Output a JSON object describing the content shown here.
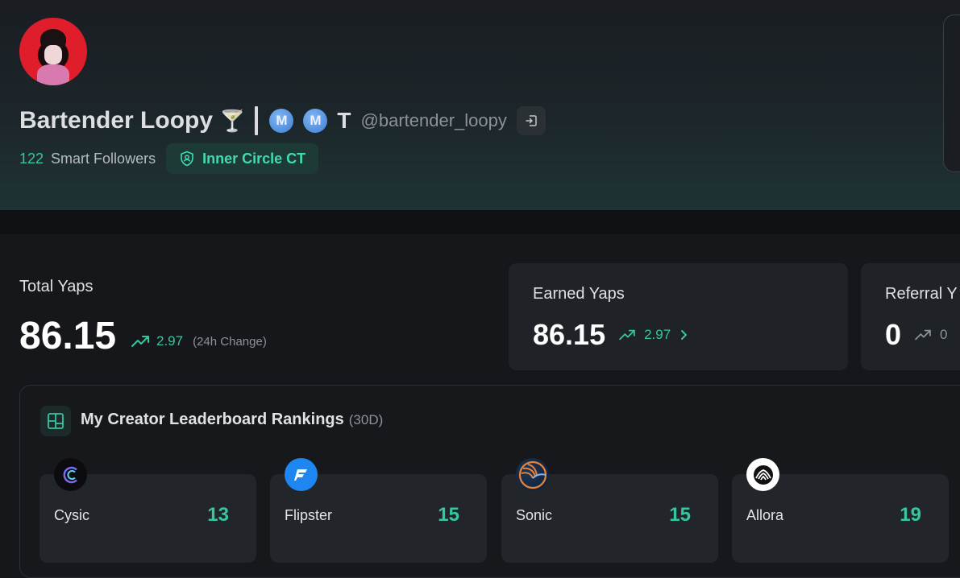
{
  "profile": {
    "name": "Bartender Loopy",
    "cocktail_emoji": "🍸",
    "badge_letter_1": "M",
    "badge_letter_2": "M",
    "extra_letter": "T",
    "handle": "@bartender_loopy",
    "smart_followers_count": "122",
    "smart_followers_label": "Smart Followers",
    "circle_badge": "Inner Circle CT"
  },
  "stats": {
    "total": {
      "label": "Total Yaps",
      "value": "86.15",
      "change": "2.97",
      "change_note": "(24h Change)"
    },
    "earned": {
      "label": "Earned Yaps",
      "value": "86.15",
      "change": "2.97"
    },
    "referral": {
      "label": "Referral Y",
      "value": "0",
      "change": "0"
    }
  },
  "leaderboard": {
    "title": "My Creator Leaderboard Rankings",
    "period": "(30D)",
    "items": [
      {
        "name": "Cysic",
        "rank": "13"
      },
      {
        "name": "Flipster",
        "rank": "15"
      },
      {
        "name": "Sonic",
        "rank": "15"
      },
      {
        "name": "Allora",
        "rank": "19"
      }
    ]
  },
  "colors": {
    "accent": "#35c6a2",
    "background": "#15171b",
    "card": "#1f2226"
  }
}
